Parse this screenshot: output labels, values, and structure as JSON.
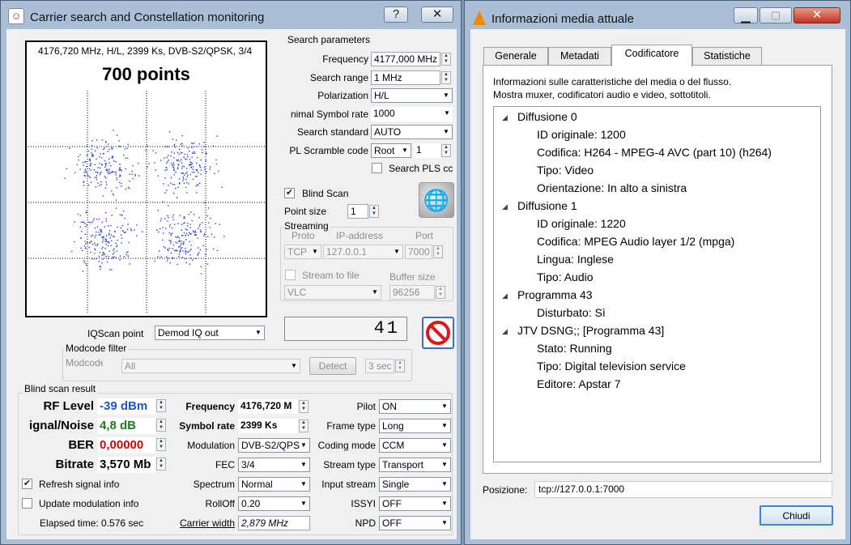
{
  "win1": {
    "title": "Carrier search and Constellation monitoring",
    "help_btn": "?",
    "close_btn": "✕",
    "const_info": "4176,720 MHz, H/L, 2399 Ks, DVB-S2/QPSK, 3/4",
    "points_label": "700 points",
    "search": {
      "group_title": "Search parameters",
      "frequency_label": "Frequency",
      "frequency_value": "4177,000 MHz",
      "range_label": "Search range",
      "range_value": "1 MHz",
      "polarization_label": "Polarization",
      "polarization_value": "H/L",
      "min_sr_label": "nimal Symbol rate",
      "min_sr_value": "1000",
      "standard_label": "Search standard",
      "standard_value": "AUTO",
      "pls_label": "PL Scramble code",
      "pls_mode": "Root",
      "pls_value": "1",
      "search_pls_label": "Search PLS cc"
    },
    "blind_scan_label": "Blind Scan",
    "point_size_label": "Point size",
    "point_size_value": "1",
    "streaming": {
      "group_title": "Streaming",
      "proto_label": "Proto",
      "ip_label": "IP-address",
      "port_label": "Port",
      "proto_value": "TCP",
      "ip_value": "127.0.0.1",
      "port_value": "7000",
      "stream_file_label": "Stream to file",
      "buffer_label": "Buffer size",
      "player_value": "VLC",
      "buffer_value": "96256"
    },
    "counter_value": "41",
    "iqscan_label": "IQScan point",
    "iqscan_value": "Demod IQ out",
    "modcode": {
      "group_title": "Modcode filter",
      "modcode_label": "Modcode",
      "modcode_value": "All",
      "detect_label": "Detect",
      "time_value": "3 sec"
    },
    "result": {
      "group_title": "Blind scan result",
      "rf_label": "RF Level",
      "rf_value": "-39 dBm",
      "sn_label": "ignal/Noise",
      "sn_value": "4,8 dB",
      "ber_label": "BER",
      "ber_value": "0,00000",
      "bitrate_label": "Bitrate",
      "bitrate_value": "3,570 Mb",
      "freq_label": "Frequency",
      "freq_value": "4176,720 M",
      "sr_label": "Symbol rate",
      "sr_value": "2399 Ks",
      "mod_label": "Modulation",
      "mod_value": "DVB-S2/QPS",
      "fec_label": "FEC",
      "fec_value": "3/4",
      "spectrum_label": "Spectrum",
      "spectrum_value": "Normal",
      "rolloff_label": "RollOff",
      "rolloff_value": "0.20",
      "cw_label": "Carrier width",
      "cw_value": "2,879 MHz",
      "pilot_label": "Pilot",
      "pilot_value": "ON",
      "frame_label": "Frame type",
      "frame_value": "Long",
      "coding_label": "Coding mode",
      "coding_value": "CCM",
      "stype_label": "Stream type",
      "stype_value": "Transport",
      "istream_label": "Input stream",
      "istream_value": "Single",
      "issyi_label": "ISSYI",
      "issyi_value": "OFF",
      "npd_label": "NPD",
      "npd_value": "OFF",
      "refresh_label": "Refresh signal info",
      "update_label": "Update modulation info",
      "elapsed": "Elapsed time: 0.576 sec"
    }
  },
  "win2": {
    "title": "Informazioni media attuale",
    "tabs": [
      "Generale",
      "Metadati",
      "Codificatore",
      "Statistiche"
    ],
    "desc1": "Informazioni sulle caratteristiche del media o del flusso.",
    "desc2": "Mostra muxer, codificatori audio e video, sottotitoli.",
    "tree": [
      {
        "text": "Diffusione 0",
        "level": 0
      },
      {
        "text": "ID originale: 1200",
        "level": 1
      },
      {
        "text": "Codifica: H264 - MPEG-4 AVC (part 10) (h264)",
        "level": 1
      },
      {
        "text": "Tipo: Video",
        "level": 1
      },
      {
        "text": "Orientazione: In alto a sinistra",
        "level": 1
      },
      {
        "text": "Diffusione 1",
        "level": 0
      },
      {
        "text": "ID originale: 1220",
        "level": 1
      },
      {
        "text": "Codifica: MPEG Audio layer 1/2 (mpga)",
        "level": 1
      },
      {
        "text": "Lingua: Inglese",
        "level": 1
      },
      {
        "text": "Tipo: Audio",
        "level": 1
      },
      {
        "text": "Programma 43",
        "level": 0
      },
      {
        "text": "Disturbato: Sì",
        "level": 1
      },
      {
        "text": "JTV DSNG;; [Programma 43]",
        "level": 0
      },
      {
        "text": "Stato: Running",
        "level": 1
      },
      {
        "text": "Tipo: Digital television service",
        "level": 1
      },
      {
        "text": "Editore: Apstar 7",
        "level": 1
      }
    ],
    "position_label": "Posizione:",
    "position_value": "tcp://127.0.0.1:7000",
    "close_label": "Chiudi"
  }
}
